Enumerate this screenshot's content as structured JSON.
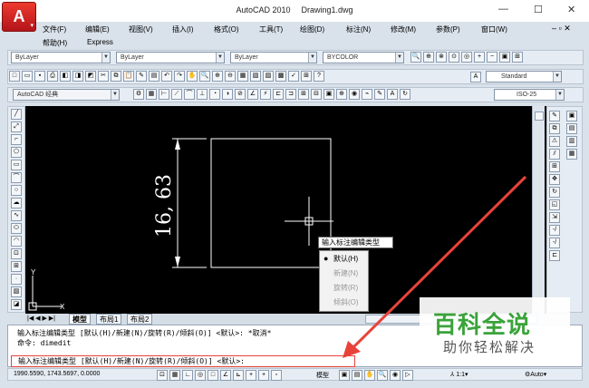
{
  "app": {
    "title": "AutoCAD 2010",
    "document": "Drawing1.dwg",
    "logo_glyph": "A"
  },
  "window": {
    "minimize": "—",
    "restore": "☐",
    "close": "✕"
  },
  "menus": [
    "文件(F)",
    "编辑(E)",
    "视图(V)",
    "插入(I)",
    "格式(O)",
    "工具(T)",
    "绘图(D)",
    "标注(N)",
    "修改(M)",
    "参数(P)",
    "窗口(W)",
    "帮助(H)",
    "Express"
  ],
  "properties": {
    "layer": "ByLayer",
    "color": "ByLayer",
    "linetype": "ByLayer",
    "lineweight": "BYCOLOR"
  },
  "workspace": "AutoCAD 经典",
  "text_style": "Standard",
  "dim_style": "ISO-25",
  "drawing": {
    "dimension_text": "16, 63"
  },
  "tabs": [
    "模型",
    "布局1",
    "布局2"
  ],
  "popup": {
    "title": "输入标注编辑类型",
    "options": [
      "默认(H)",
      "新建(N)",
      "旋转(R)",
      "倾斜(O)"
    ],
    "selected": 0
  },
  "command": {
    "line1": "输入标注编辑类型 [默认(H)/新建(N)/旋转(R)/倾斜(O)] <默认>: *取消*",
    "line2": "命令: dimedit",
    "line3": "输入标注编辑类型 [默认(H)/新建(N)/旋转(R)/倾斜(O)] <默认>:"
  },
  "status": {
    "coords": "1990.5590, 1743.5697, 0.0000",
    "model": "模型",
    "scale": "1:1",
    "auto": "Auto"
  },
  "watermark": {
    "big": "百科全说",
    "small": "助你轻松解决"
  },
  "colors": {
    "accent": "#e8423a",
    "canvas": "#000000",
    "watermark_green": "#3aa33a"
  }
}
